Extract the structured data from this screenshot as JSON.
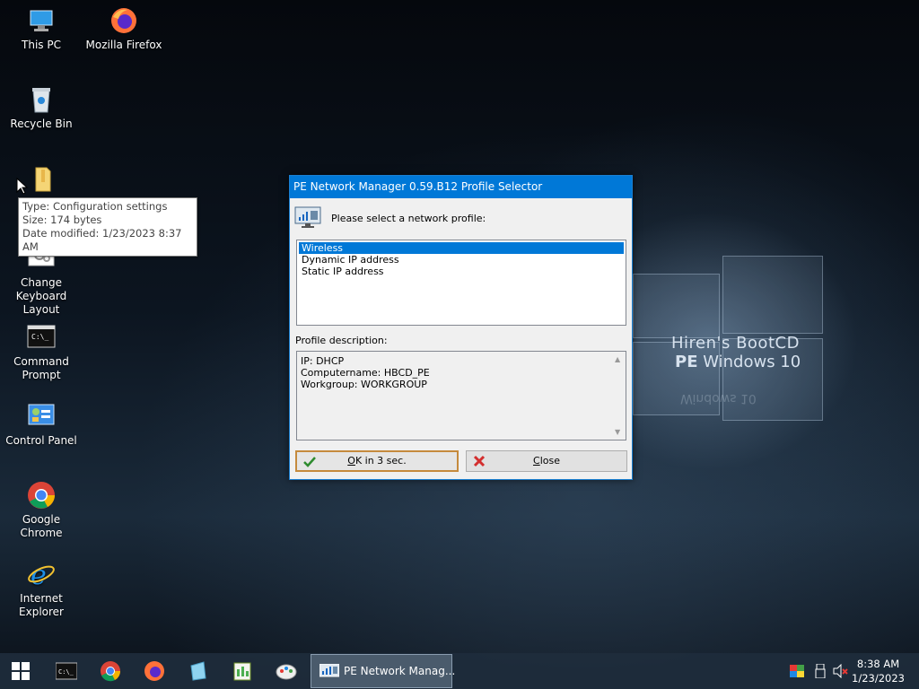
{
  "desktop": {
    "icons": [
      {
        "label": "This PC",
        "icon": "this-pc-icon"
      },
      {
        "label": "Mozilla Firefox",
        "icon": "firefox-icon"
      },
      {
        "label": "Recycle Bin",
        "icon": "recycle-bin-icon"
      },
      {
        "label": "Change Keyboard Layout",
        "icon": "keyboard-settings-icon"
      },
      {
        "label": "Command Prompt",
        "icon": "command-prompt-icon"
      },
      {
        "label": "Control Panel",
        "icon": "control-panel-icon"
      },
      {
        "label": "Google Chrome",
        "icon": "chrome-icon"
      },
      {
        "label": "Internet Explorer",
        "icon": "internet-explorer-icon"
      }
    ],
    "tooltip": {
      "type": "Type: Configuration settings",
      "size": "Size: 174 bytes",
      "modified": "Date modified: 1/23/2023 8:37 AM"
    },
    "branding": {
      "line1": "Hiren's BootCD",
      "line2_bold": "PE",
      "line2_rest": "Windows 10"
    }
  },
  "dialog": {
    "title": "PE Network Manager 0.59.B12 Profile Selector",
    "prompt": "Please select a network profile:",
    "profiles": [
      "Wireless",
      "Dynamic IP address",
      "Static IP address"
    ],
    "selected_profile": "Wireless",
    "description_label": "Profile description:",
    "description_lines": [
      "IP: DHCP",
      "Computername: HBCD_PE",
      "Workgroup: WORKGROUP"
    ],
    "ok_button": {
      "mnemonic": "O",
      "rest": "K in 3 sec."
    },
    "close_button": {
      "mnemonic": "C",
      "rest": "lose"
    }
  },
  "taskbar": {
    "pinned": [
      "start-icon",
      "command-prompt-icon",
      "chrome-icon",
      "firefox-icon",
      "notepad-icon",
      "registry-icon",
      "paint-icon"
    ],
    "active_window": "PE Network Manag...",
    "tray_icons": [
      "color-icon",
      "usb-icon",
      "volume-muted-icon"
    ],
    "time": "8:38 AM",
    "date": "1/23/2023"
  },
  "colors": {
    "accent": "#0078d7",
    "taskbar": "#1e2d3c",
    "dialog_bg": "#f0f0f0"
  }
}
